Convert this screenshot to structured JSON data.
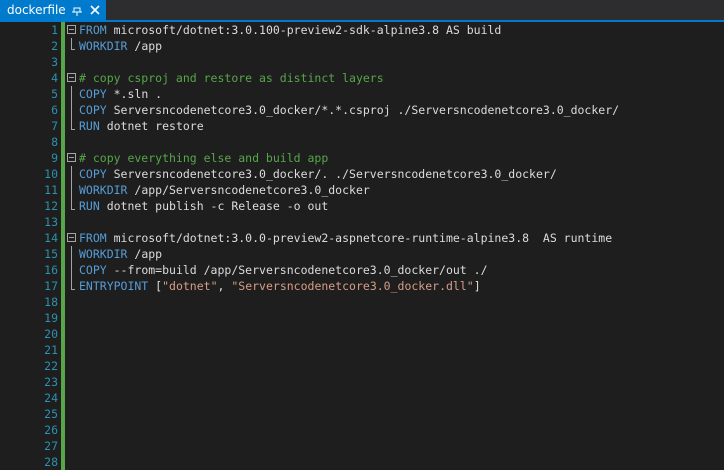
{
  "tab": {
    "title": "dockerfile",
    "pin_icon": "pin-icon",
    "close_icon": "close-icon"
  },
  "colors": {
    "tab_active": "#007acc",
    "background": "#1e1e1e",
    "line_number": "#2b91af",
    "keyword": "#569cd6",
    "comment": "#57a64a",
    "string": "#d69d85",
    "text": "#dcdcdc",
    "change_marker": "#57a64a"
  },
  "lines": [
    {
      "n": "1",
      "fold": "start",
      "changed": true,
      "tokens": [
        {
          "t": "FROM",
          "k": "kw"
        },
        {
          "t": " microsoft/dotnet:3.0.100-preview2-sdk-alpine3.8 AS build",
          "k": "tx"
        }
      ]
    },
    {
      "n": "2",
      "fold": "end",
      "changed": true,
      "tokens": [
        {
          "t": "WORKDIR",
          "k": "kw"
        },
        {
          "t": " /app",
          "k": "tx"
        }
      ]
    },
    {
      "n": "3",
      "fold": "",
      "changed": true,
      "tokens": []
    },
    {
      "n": "4",
      "fold": "start",
      "changed": true,
      "tokens": [
        {
          "t": "# copy csproj and restore as distinct layers",
          "k": "cm"
        }
      ]
    },
    {
      "n": "5",
      "fold": "mid",
      "changed": true,
      "tokens": [
        {
          "t": "COPY",
          "k": "kw"
        },
        {
          "t": " *.sln .",
          "k": "tx"
        }
      ]
    },
    {
      "n": "6",
      "fold": "mid",
      "changed": true,
      "tokens": [
        {
          "t": "COPY",
          "k": "kw"
        },
        {
          "t": " Serversncodenetcore3.0_docker/*.*.csproj ./Serversncodenetcore3.0_docker/",
          "k": "tx"
        }
      ]
    },
    {
      "n": "7",
      "fold": "end",
      "changed": true,
      "tokens": [
        {
          "t": "RUN",
          "k": "kw"
        },
        {
          "t": " dotnet restore",
          "k": "tx"
        }
      ]
    },
    {
      "n": "8",
      "fold": "",
      "changed": true,
      "tokens": []
    },
    {
      "n": "9",
      "fold": "start",
      "changed": true,
      "tokens": [
        {
          "t": "# copy everything else and build app",
          "k": "cm"
        }
      ]
    },
    {
      "n": "10",
      "fold": "mid",
      "changed": true,
      "tokens": [
        {
          "t": "COPY",
          "k": "kw"
        },
        {
          "t": " Serversncodenetcore3.0_docker/. ./Serversncodenetcore3.0_docker/",
          "k": "tx"
        }
      ]
    },
    {
      "n": "11",
      "fold": "mid",
      "changed": true,
      "tokens": [
        {
          "t": "WORKDIR",
          "k": "kw"
        },
        {
          "t": " /app/Serversncodenetcore3.0_docker",
          "k": "tx"
        }
      ]
    },
    {
      "n": "12",
      "fold": "end",
      "changed": true,
      "tokens": [
        {
          "t": "RUN",
          "k": "kw"
        },
        {
          "t": " dotnet publish -c Release -o out",
          "k": "tx"
        }
      ]
    },
    {
      "n": "13",
      "fold": "",
      "changed": true,
      "tokens": []
    },
    {
      "n": "14",
      "fold": "start",
      "changed": true,
      "tokens": [
        {
          "t": "FROM",
          "k": "kw"
        },
        {
          "t": " microsoft/dotnet:3.0.0-preview2-aspnetcore-runtime-alpine3.8  AS runtime",
          "k": "tx"
        }
      ]
    },
    {
      "n": "15",
      "fold": "mid",
      "changed": true,
      "tokens": [
        {
          "t": "WORKDIR",
          "k": "kw"
        },
        {
          "t": " /app",
          "k": "tx"
        }
      ]
    },
    {
      "n": "16",
      "fold": "mid",
      "changed": true,
      "tokens": [
        {
          "t": "COPY",
          "k": "kw"
        },
        {
          "t": " --from=build /app/Serversncodenetcore3.0_docker/out ./",
          "k": "tx"
        }
      ]
    },
    {
      "n": "17",
      "fold": "end",
      "changed": true,
      "tokens": [
        {
          "t": "ENTRYPOINT",
          "k": "kw"
        },
        {
          "t": " [",
          "k": "tx"
        },
        {
          "t": "\"dotnet\"",
          "k": "st"
        },
        {
          "t": ", ",
          "k": "tx"
        },
        {
          "t": "\"Serversncodenetcore3.0_docker.dll\"",
          "k": "st"
        },
        {
          "t": "]",
          "k": "tx"
        }
      ]
    },
    {
      "n": "18",
      "fold": "",
      "changed": true,
      "tokens": []
    },
    {
      "n": "19",
      "fold": "",
      "changed": true,
      "tokens": []
    },
    {
      "n": "20",
      "fold": "",
      "changed": true,
      "tokens": []
    },
    {
      "n": "21",
      "fold": "",
      "changed": true,
      "tokens": []
    },
    {
      "n": "22",
      "fold": "",
      "changed": true,
      "tokens": []
    },
    {
      "n": "23",
      "fold": "",
      "changed": true,
      "tokens": []
    },
    {
      "n": "24",
      "fold": "",
      "changed": true,
      "tokens": []
    },
    {
      "n": "25",
      "fold": "",
      "changed": true,
      "tokens": []
    },
    {
      "n": "26",
      "fold": "",
      "changed": true,
      "tokens": []
    },
    {
      "n": "27",
      "fold": "",
      "changed": true,
      "tokens": []
    },
    {
      "n": "28",
      "fold": "",
      "changed": true,
      "tokens": []
    }
  ]
}
